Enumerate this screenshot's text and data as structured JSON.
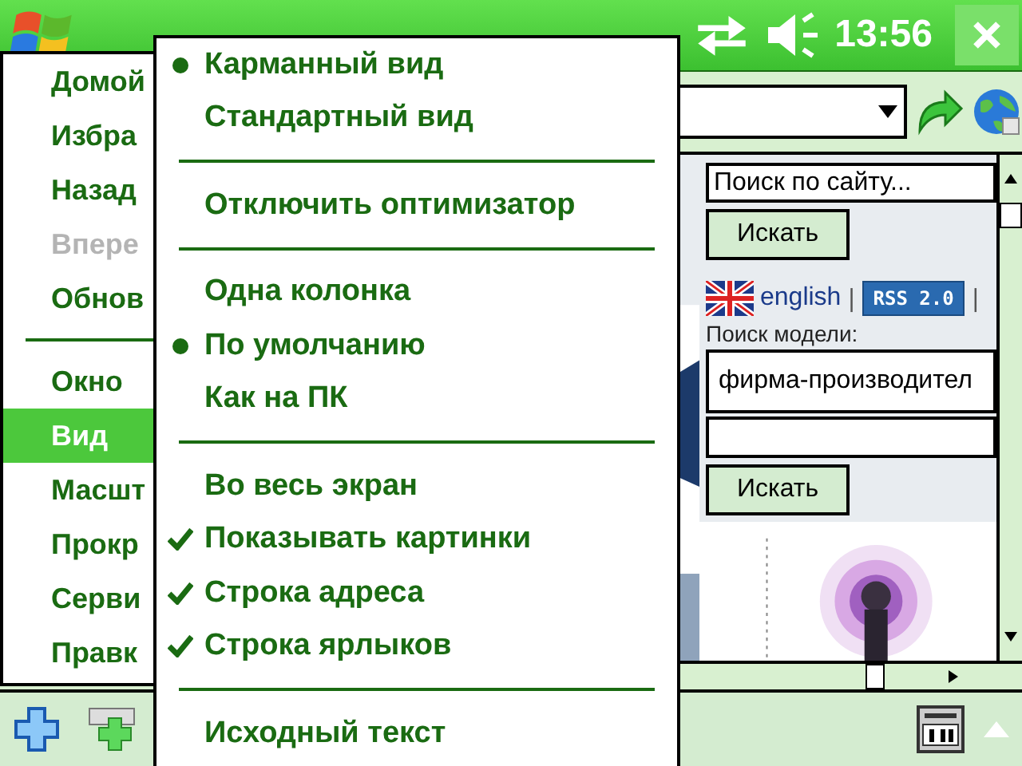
{
  "title_bar": {
    "time": "13:56"
  },
  "page": {
    "site_search": {
      "value": "Поиск по сайту...",
      "button": "Искать"
    },
    "language_link": "english",
    "separator_1": "|",
    "rss_badge": "RSS 2.0",
    "separator_2": "|",
    "model_search": {
      "label": "Поиск модели:",
      "value": "фирма-производител",
      "button": "Искать"
    }
  },
  "main_menu": {
    "items": [
      {
        "kind": "item",
        "label": "Домой",
        "disabled": false,
        "selected": false
      },
      {
        "kind": "item",
        "label": "Избра",
        "disabled": false,
        "selected": false
      },
      {
        "kind": "item",
        "label": "Назад",
        "disabled": false,
        "selected": false
      },
      {
        "kind": "item",
        "label": "Впере",
        "disabled": true,
        "selected": false
      },
      {
        "kind": "item",
        "label": "Обнов",
        "disabled": false,
        "selected": false
      },
      {
        "kind": "separator"
      },
      {
        "kind": "item",
        "label": "Окно",
        "disabled": false,
        "selected": false
      },
      {
        "kind": "item",
        "label": "Вид",
        "disabled": false,
        "selected": true
      },
      {
        "kind": "item",
        "label": "Масшт",
        "disabled": false,
        "selected": false
      },
      {
        "kind": "item",
        "label": "Прокр",
        "disabled": false,
        "selected": false
      },
      {
        "kind": "item",
        "label": "Серви",
        "disabled": false,
        "selected": false
      },
      {
        "kind": "item",
        "label": "Правк",
        "disabled": false,
        "selected": false
      }
    ]
  },
  "view_submenu": {
    "items": [
      {
        "kind": "radio",
        "label": "Карманный вид",
        "selected": true
      },
      {
        "kind": "radio",
        "label": "Стандартный вид",
        "selected": false
      },
      {
        "kind": "separator"
      },
      {
        "kind": "command",
        "label": "Отключить оптимизатор"
      },
      {
        "kind": "separator"
      },
      {
        "kind": "radio",
        "label": "Одна колонка",
        "selected": false
      },
      {
        "kind": "radio",
        "label": "По умолчанию",
        "selected": true
      },
      {
        "kind": "radio",
        "label": "Как на ПК",
        "selected": false
      },
      {
        "kind": "separator"
      },
      {
        "kind": "check",
        "label": "Во весь экран",
        "checked": false
      },
      {
        "kind": "check",
        "label": "Показывать картинки",
        "checked": true
      },
      {
        "kind": "check",
        "label": "Строка адреса",
        "checked": true
      },
      {
        "kind": "check",
        "label": "Строка ярлыков",
        "checked": true
      },
      {
        "kind": "separator"
      },
      {
        "kind": "command",
        "label": "Исходный текст"
      }
    ]
  }
}
